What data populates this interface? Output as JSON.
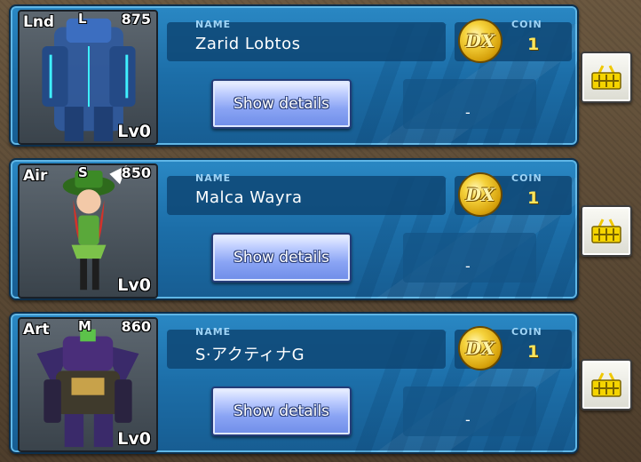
{
  "units": [
    {
      "type": "Lnd",
      "rank": "L",
      "cost": "875",
      "level": "Lv0",
      "name_label": "NAME",
      "name": "Zarid Lobtos",
      "details_label": "Show details",
      "coin_label": "COIN",
      "coin_value": "1",
      "coin_icon": "DX",
      "extra": "-",
      "icon": "basket-icon",
      "portrait_color": "#2f5aa0"
    },
    {
      "type": "Air",
      "rank": "S",
      "cost": "850",
      "level": "Lv0",
      "name_label": "NAME",
      "name": "Malca Wayra",
      "details_label": "Show details",
      "coin_label": "COIN",
      "coin_value": "1",
      "coin_icon": "DX",
      "extra": "-",
      "icon": "basket-icon",
      "portrait_color": "#5aa83a"
    },
    {
      "type": "Art",
      "rank": "M",
      "cost": "860",
      "level": "Lv0",
      "name_label": "NAME",
      "name": "S·アクティナG",
      "details_label": "Show details",
      "coin_label": "COIN",
      "coin_value": "1",
      "coin_icon": "DX",
      "extra": "-",
      "icon": "basket-icon",
      "portrait_color": "#4a2e7a"
    }
  ]
}
